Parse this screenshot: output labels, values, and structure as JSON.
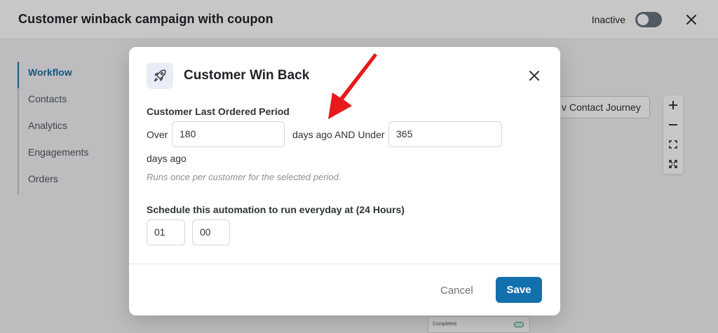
{
  "header": {
    "title": "Customer winback campaign with coupon",
    "status_label": "Inactive"
  },
  "sidebar": {
    "items": [
      {
        "label": "Workflow"
      },
      {
        "label": "Contacts"
      },
      {
        "label": "Analytics"
      },
      {
        "label": "Engagements"
      },
      {
        "label": "Orders"
      }
    ]
  },
  "canvas": {
    "journey_button": "v Contact Journey",
    "node_status": "Completed"
  },
  "modal": {
    "title": "Customer Win Back",
    "period_label": "Customer Last Ordered Period",
    "over_text": "Over",
    "over_value": "180",
    "between_text": "days ago AND Under",
    "under_value": "365",
    "days_ago_text": "days ago",
    "helper_text": "Runs once per customer for the selected period.",
    "schedule_label": "Schedule this automation to run everyday at (24 Hours)",
    "hour_value": "01",
    "minute_value": "00",
    "cancel_label": "Cancel",
    "save_label": "Save"
  },
  "colors": {
    "accent": "#1270ad",
    "annotation": "#e8191c"
  }
}
